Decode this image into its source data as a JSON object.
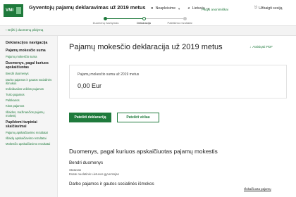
{
  "header": {
    "logo_text": "VMI",
    "app_title": "Gyventojų pajamų deklaravimas už 2019 metus",
    "user_name": "Neapleisime",
    "language": "Lietuvių",
    "help_link": "Pildyti anonimiškai",
    "logout_label": "Užbaigti sesiją"
  },
  "stepper": {
    "steps": [
      {
        "label": "Duomenų tvarkymas",
        "state": "done"
      },
      {
        "label": "Deklaracija",
        "state": "current"
      },
      {
        "label": "Pateikimo rezultatai",
        "state": "pending"
      }
    ]
  },
  "breadcrumb": {
    "back_label": "‹ Grįžti į duomenų pildymą"
  },
  "sidebar": {
    "title": "Deklaracijos navigacija",
    "sections": [
      {
        "heading": "Pajamų mokesčio suma",
        "links": [
          "Pajamų mokesčio suma"
        ]
      },
      {
        "heading": "Duomenys, pagal kuriuos apskaičiuotas",
        "links": [
          "Bendri duomenys",
          "Darbo pajamos ir gautos socialinės išmokos",
          "Individualios veiklos pajamos",
          "Turto pajamos",
          "Palūkanos",
          "Kitos pajamos",
          "Išlaidos, mažinančios pajamų mokestį"
        ]
      },
      {
        "heading": "Papildomi tarpiniai skaičiavimai",
        "links": [
          "Pajamų apskaičiavimo rezultatai",
          "Išlaidų apskaičiavimo rezultatai",
          "Mokesčio apskaičiavimo rezultatai"
        ]
      }
    ]
  },
  "main": {
    "page_title": "Pajamų mokesčio deklaracija už 2019 metus",
    "pdf_link": "Atsisiųsti PDF",
    "tax_label": "Pajamų mokesčio suma už 2019 metus",
    "tax_amount": "0,00 Eur",
    "submit_button": "Pateikti deklaraciją",
    "later_button": "Pateikti vėliau",
    "section_title": "Duomenys, pagal kuriuos apskaičiuotas pajamų mokestis",
    "general_title": "Bendri duomenys",
    "status_label": "Statusas",
    "status_value": "Esate nuolatinis Lietuvos gyventojas",
    "income_title": "Darbo pajamos ir gautos socialinės išmokos",
    "right_note": "Išskaičiuota pajamų"
  },
  "colors": {
    "accent": "#1f7a3c",
    "sidebar_bg": "#f5f5f5"
  }
}
